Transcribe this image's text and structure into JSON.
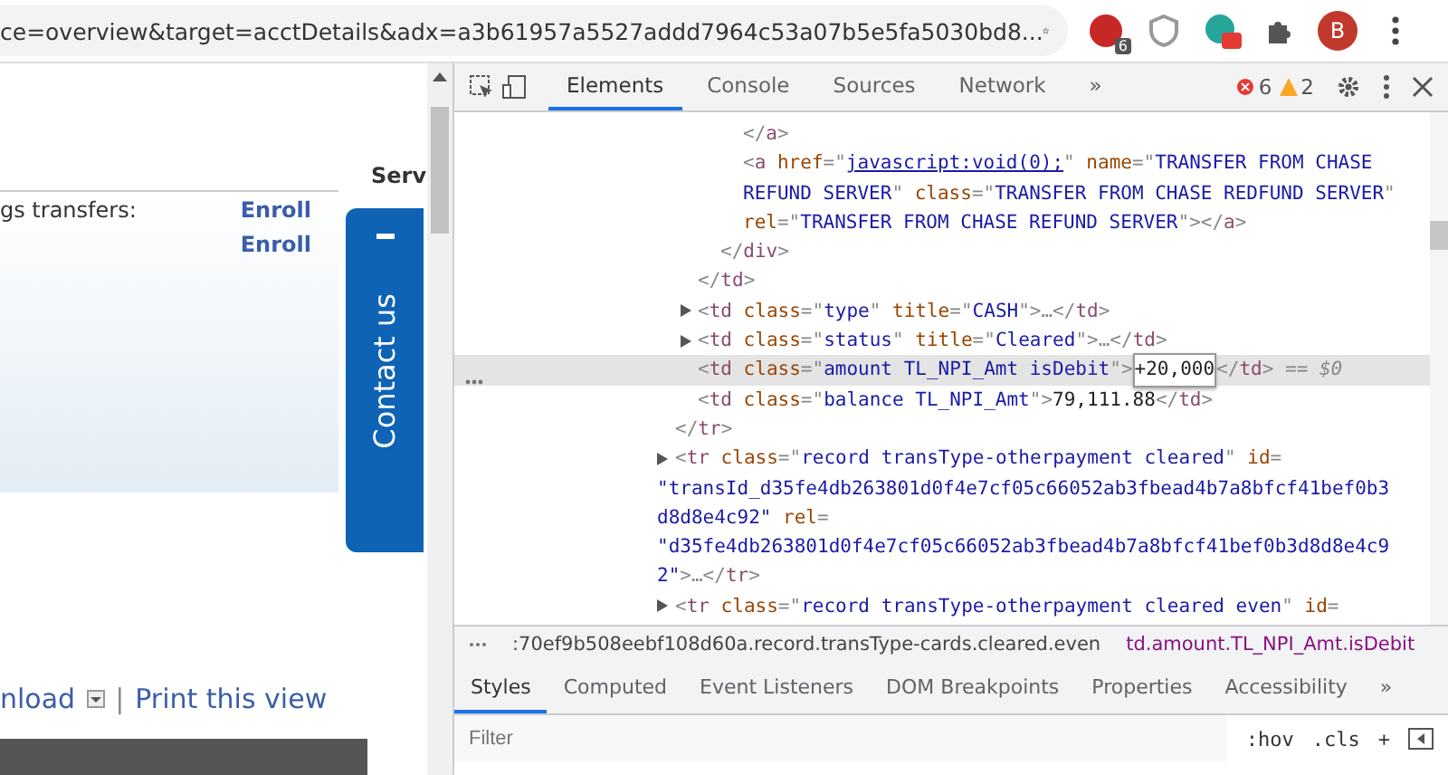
{
  "browser": {
    "url": "ce=overview&target=acctDetails&adx=a3b61957a5527addd7964c53a07b5e5fa5030bd8...",
    "extension_badge": "6",
    "profile_initial": "B"
  },
  "page": {
    "section_heading": "Serv",
    "transfer_rows": [
      {
        "label": "gs transfers:",
        "link": "Enroll"
      },
      {
        "label": "",
        "link": "Enroll"
      }
    ],
    "contact_tab": "Contact us",
    "separator": "|",
    "actions": [
      {
        "label": "nload",
        "dropdown": true
      },
      {
        "label": "Print this view",
        "dropdown": false
      }
    ]
  },
  "devtools": {
    "tabs": [
      {
        "label": "Elements",
        "selected": true
      },
      {
        "label": "Console",
        "selected": false
      },
      {
        "label": "Sources",
        "selected": false
      },
      {
        "label": "Network",
        "selected": false
      }
    ],
    "more_tabs": "»",
    "errors": "6",
    "warnings": "2",
    "dom_tree": [
      {
        "children": [
          {
            "children": [
              {
                "children": [
                  {
                    "selected": false,
                    "lines": [
                      [
                        {
                          "kind": "punct",
                          "text": "</"
                        },
                        {
                          "kind": "tag",
                          "text": "a"
                        },
                        {
                          "kind": "punct",
                          "text": ">"
                        }
                      ]
                    ]
                  },
                  {
                    "selected": false,
                    "lines": [
                      [
                        {
                          "kind": "punct",
                          "text": "<"
                        },
                        {
                          "kind": "tag",
                          "text": "a"
                        },
                        {
                          "kind": "attr",
                          "text": " href"
                        },
                        {
                          "kind": "punct",
                          "text": "=\""
                        },
                        {
                          "kind": "link",
                          "text": "javascript:void(0);"
                        },
                        {
                          "kind": "punct",
                          "text": "\""
                        },
                        {
                          "kind": "attr",
                          "text": " name"
                        },
                        {
                          "kind": "punct",
                          "text": "=\""
                        },
                        {
                          "kind": "value",
                          "text": "TRANSFER FROM CHASE"
                        }
                      ],
                      [
                        {
                          "kind": "value",
                          "text": "REFUND SERVER"
                        },
                        {
                          "kind": "punct",
                          "text": "\""
                        },
                        {
                          "kind": "attr",
                          "text": " class"
                        },
                        {
                          "kind": "punct",
                          "text": "=\""
                        },
                        {
                          "kind": "value",
                          "text": "TRANSFER FROM CHASE REDFUND SERVER"
                        },
                        {
                          "kind": "punct",
                          "text": "\""
                        }
                      ],
                      [
                        {
                          "kind": "attr",
                          "text": "rel"
                        },
                        {
                          "kind": "punct",
                          "text": "=\""
                        },
                        {
                          "kind": "value",
                          "text": "TRANSFER FROM CHASE REFUND SERVER"
                        },
                        {
                          "kind": "punct",
                          "text": "\"></"
                        },
                        {
                          "kind": "tag",
                          "text": "a"
                        },
                        {
                          "kind": "punct",
                          "text": ">"
                        }
                      ]
                    ]
                  }
                ]
              },
              {
                "selected": false,
                "lines": [
                  [
                    {
                      "kind": "punct",
                      "text": "</"
                    },
                    {
                      "kind": "tag",
                      "text": "div"
                    },
                    {
                      "kind": "punct",
                      "text": ">"
                    }
                  ]
                ]
              }
            ]
          },
          {
            "selected": false,
            "lines": [
              [
                {
                  "kind": "punct",
                  "text": "</"
                },
                {
                  "kind": "tag",
                  "text": "td"
                },
                {
                  "kind": "punct",
                  "text": ">"
                }
              ]
            ]
          },
          {
            "selected": false,
            "expanded": false,
            "lines": [
              [
                {
                  "kind": "punct",
                  "text": "<"
                },
                {
                  "kind": "tag",
                  "text": "td"
                },
                {
                  "kind": "attr",
                  "text": " class"
                },
                {
                  "kind": "punct",
                  "text": "=\""
                },
                {
                  "kind": "value",
                  "text": "type"
                },
                {
                  "kind": "punct",
                  "text": "\""
                },
                {
                  "kind": "attr",
                  "text": " title"
                },
                {
                  "kind": "punct",
                  "text": "=\""
                },
                {
                  "kind": "value",
                  "text": "CASH"
                },
                {
                  "kind": "punct",
                  "text": "\">…</"
                },
                {
                  "kind": "tag",
                  "text": "td"
                },
                {
                  "kind": "punct",
                  "text": ">"
                }
              ]
            ]
          },
          {
            "selected": false,
            "expanded": false,
            "lines": [
              [
                {
                  "kind": "punct",
                  "text": "<"
                },
                {
                  "kind": "tag",
                  "text": "td"
                },
                {
                  "kind": "attr",
                  "text": " class"
                },
                {
                  "kind": "punct",
                  "text": "=\""
                },
                {
                  "kind": "value",
                  "text": "status"
                },
                {
                  "kind": "punct",
                  "text": "\""
                },
                {
                  "kind": "attr",
                  "text": " title"
                },
                {
                  "kind": "punct",
                  "text": "=\""
                },
                {
                  "kind": "value",
                  "text": "Cleared"
                },
                {
                  "kind": "punct",
                  "text": "\">…</"
                },
                {
                  "kind": "tag",
                  "text": "td"
                },
                {
                  "kind": "punct",
                  "text": ">"
                }
              ]
            ]
          },
          {
            "selected": true,
            "lines": [
              [
                {
                  "kind": "punct",
                  "text": "<"
                },
                {
                  "kind": "tag",
                  "text": "td"
                },
                {
                  "kind": "attr",
                  "text": " class"
                },
                {
                  "kind": "punct",
                  "text": "=\""
                },
                {
                  "kind": "value",
                  "text": "amount TL_NPI_Amt isDebit"
                },
                {
                  "kind": "punct",
                  "text": "\">"
                },
                {
                  "kind": "edit",
                  "text": "+20,000"
                },
                {
                  "kind": "punct",
                  "text": "</"
                },
                {
                  "kind": "tag",
                  "text": "td"
                },
                {
                  "kind": "punct",
                  "text": ">"
                },
                {
                  "kind": "note",
                  "text": " == $0"
                }
              ]
            ]
          },
          {
            "selected": false,
            "lines": [
              [
                {
                  "kind": "punct",
                  "text": "<"
                },
                {
                  "kind": "tag",
                  "text": "td"
                },
                {
                  "kind": "attr",
                  "text": " class"
                },
                {
                  "kind": "punct",
                  "text": "=\""
                },
                {
                  "kind": "value",
                  "text": "balance TL_NPI_Amt"
                },
                {
                  "kind": "punct",
                  "text": "\">"
                },
                {
                  "kind": "text",
                  "text": "79,111.88"
                },
                {
                  "kind": "punct",
                  "text": "</"
                },
                {
                  "kind": "tag",
                  "text": "td"
                },
                {
                  "kind": "punct",
                  "text": ">"
                }
              ]
            ]
          }
        ]
      },
      {
        "selected": false,
        "lines": [
          [
            {
              "kind": "punct",
              "text": "</"
            },
            {
              "kind": "tag",
              "text": "tr"
            },
            {
              "kind": "punct",
              "text": ">"
            }
          ]
        ]
      },
      {
        "selected": false,
        "expanded": false,
        "lines": [
          [
            {
              "kind": "punct",
              "text": "<"
            },
            {
              "kind": "tag",
              "text": "tr"
            },
            {
              "kind": "attr",
              "text": " class"
            },
            {
              "kind": "punct",
              "text": "=\""
            },
            {
              "kind": "value",
              "text": "record transType-otherpayment cleared"
            },
            {
              "kind": "punct",
              "text": "\""
            },
            {
              "kind": "attr",
              "text": " id"
            },
            {
              "kind": "punct",
              "text": "="
            }
          ],
          [
            {
              "kind": "value",
              "text": "\"transId_d35fe4db263801d0f4e7cf05c66052ab3fbead4b7a8bfcf41bef0b3"
            }
          ],
          [
            {
              "kind": "value",
              "text": "d8d8e4c92\""
            },
            {
              "kind": "attr",
              "text": " rel"
            },
            {
              "kind": "punct",
              "text": "="
            }
          ],
          [
            {
              "kind": "value",
              "text": "\"d35fe4db263801d0f4e7cf05c66052ab3fbead4b7a8bfcf41bef0b3d8d8e4c9"
            }
          ],
          [
            {
              "kind": "value",
              "text": "2\""
            },
            {
              "kind": "punct",
              "text": ">…</"
            },
            {
              "kind": "tag",
              "text": "tr"
            },
            {
              "kind": "punct",
              "text": ">"
            }
          ]
        ]
      },
      {
        "selected": false,
        "expanded": false,
        "lines": [
          [
            {
              "kind": "punct",
              "text": "<"
            },
            {
              "kind": "tag",
              "text": "tr"
            },
            {
              "kind": "attr",
              "text": " class"
            },
            {
              "kind": "punct",
              "text": "=\""
            },
            {
              "kind": "value",
              "text": "record transType-otherpayment cleared even"
            },
            {
              "kind": "punct",
              "text": "\""
            },
            {
              "kind": "attr",
              "text": " id"
            },
            {
              "kind": "punct",
              "text": "="
            }
          ]
        ]
      }
    ],
    "breadcrumbs": [
      {
        "label": ":70ef9b508eebf108d60a.record.transType-cards.cleared.even",
        "selected": false
      },
      {
        "label": "td.amount.TL_NPI_Amt.isDebit",
        "selected": true
      }
    ],
    "style_tabs": [
      {
        "label": "Styles",
        "selected": true
      },
      {
        "label": "Computed",
        "selected": false
      },
      {
        "label": "Event Listeners",
        "selected": false
      },
      {
        "label": "DOM Breakpoints",
        "selected": false
      },
      {
        "label": "Properties",
        "selected": false
      },
      {
        "label": "Accessibility",
        "selected": false
      }
    ],
    "style_more_tabs": "»",
    "filter": {
      "placeholder": "Filter"
    },
    "hov": ":hov",
    "cls": ".cls",
    "add": "+"
  }
}
